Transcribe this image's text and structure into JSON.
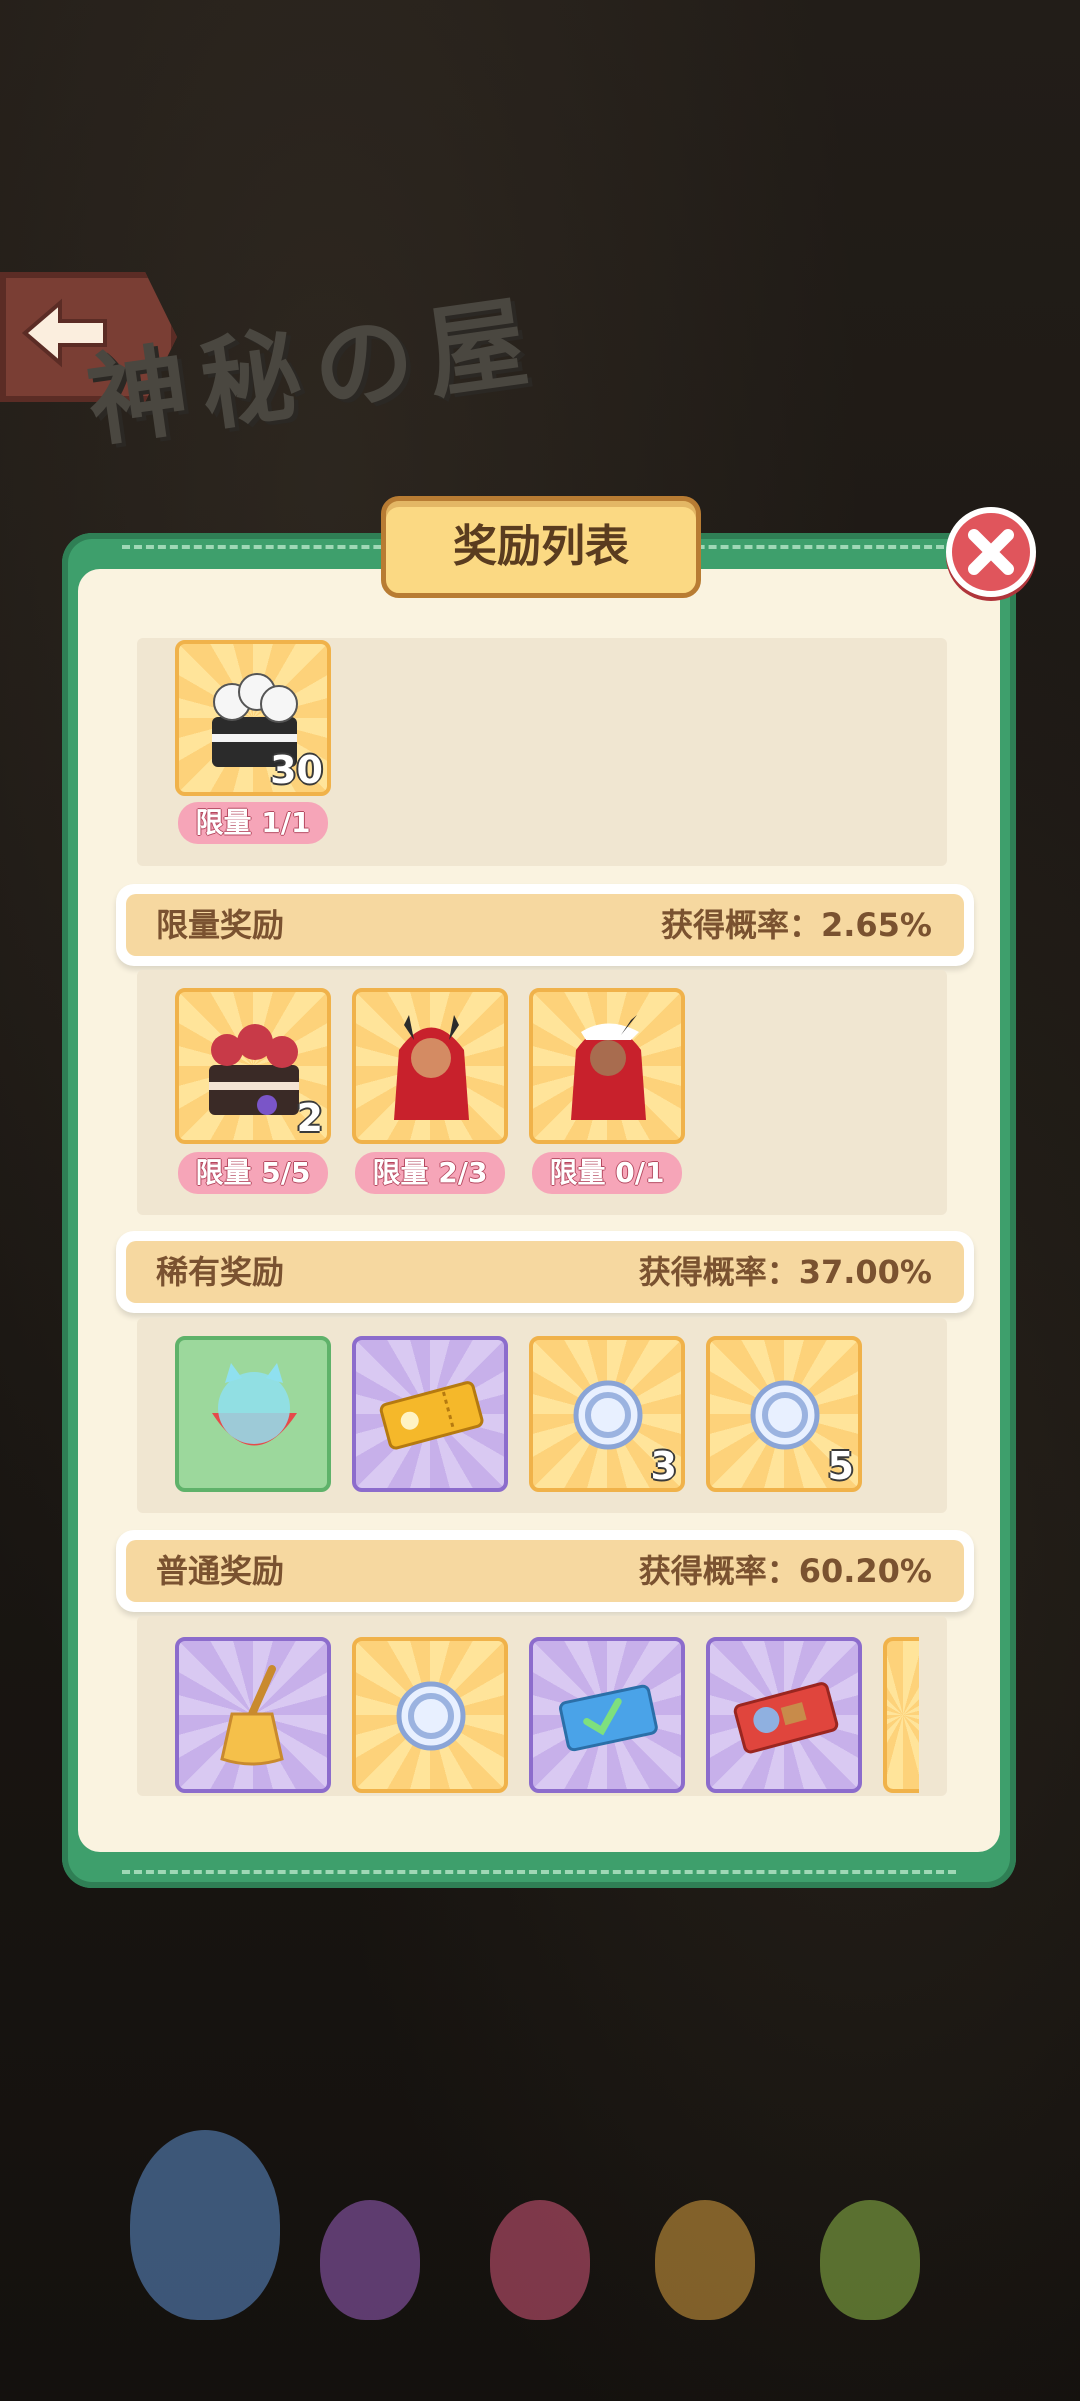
{
  "background": {
    "shop_title": "神秘の屋"
  },
  "dialog": {
    "title": "奖励列表"
  },
  "top_section": {
    "items": [
      {
        "icon": "cake-with-sheep-icon",
        "count": "30",
        "limit": "限量 1/1"
      }
    ]
  },
  "limited": {
    "name": "限量奖励",
    "rate": "获得概率：2.65%",
    "items": [
      {
        "icon": "flower-cake-icon",
        "count": "2",
        "limit": "限量 5/5"
      },
      {
        "icon": "red-hair-character-icon",
        "count": "",
        "limit": "限量 2/3"
      },
      {
        "icon": "red-hair-character-santa-icon",
        "count": "",
        "limit": "限量 0/1"
      }
    ]
  },
  "rare": {
    "name": "稀有奖励",
    "rate": "获得概率：37.00%",
    "items": [
      {
        "icon": "glass-bowl-icon",
        "count": ""
      },
      {
        "icon": "gold-ticket-icon",
        "count": ""
      },
      {
        "icon": "silver-coin-icon",
        "count": "3"
      },
      {
        "icon": "silver-coin-icon",
        "count": "5"
      }
    ]
  },
  "common": {
    "name": "普通奖励",
    "rate": "获得概率：60.20%",
    "items": [
      {
        "icon": "broom-icon",
        "count": ""
      },
      {
        "icon": "silver-coin-icon",
        "count": ""
      },
      {
        "icon": "blue-check-ticket-icon",
        "count": ""
      },
      {
        "icon": "red-character-ticket-icon",
        "count": ""
      }
    ]
  },
  "colors": {
    "panel_green": "#3e9f6c",
    "panel_cream": "#faf3e0",
    "tab_yellow": "#fbd983",
    "close_red": "#e0555c",
    "limit_pink": "#f6a5b8"
  }
}
